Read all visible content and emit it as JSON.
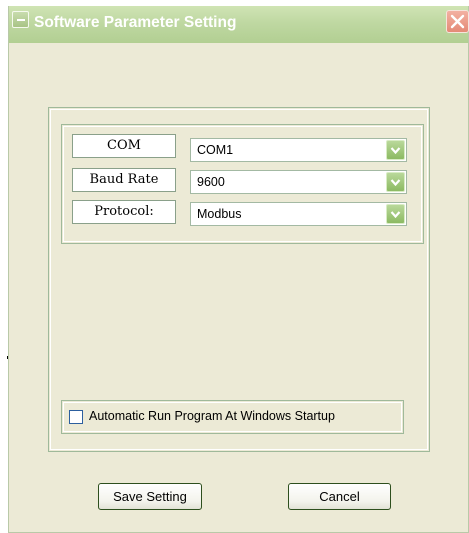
{
  "window": {
    "title": "Software Parameter Setting"
  },
  "settings": {
    "fields": [
      {
        "label": "COM",
        "value": "COM1"
      },
      {
        "label": "Baud Rate",
        "value": "9600"
      },
      {
        "label": "Protocol:",
        "value": "Modbus"
      }
    ]
  },
  "startup": {
    "label": "Automatic Run Program At Windows Startup",
    "checked": false
  },
  "buttons": {
    "save_label": "Save Setting",
    "cancel_label": "Cancel"
  },
  "colors": {
    "titlebar": "#bfd8a2",
    "window_bg": "#ecead6",
    "close_button": "#e48a76",
    "combo_arrow": "#8cba62"
  },
  "icons": {
    "system_menu": "system-menu-icon",
    "close": "close-icon",
    "dropdown": "chevron-down-icon"
  }
}
